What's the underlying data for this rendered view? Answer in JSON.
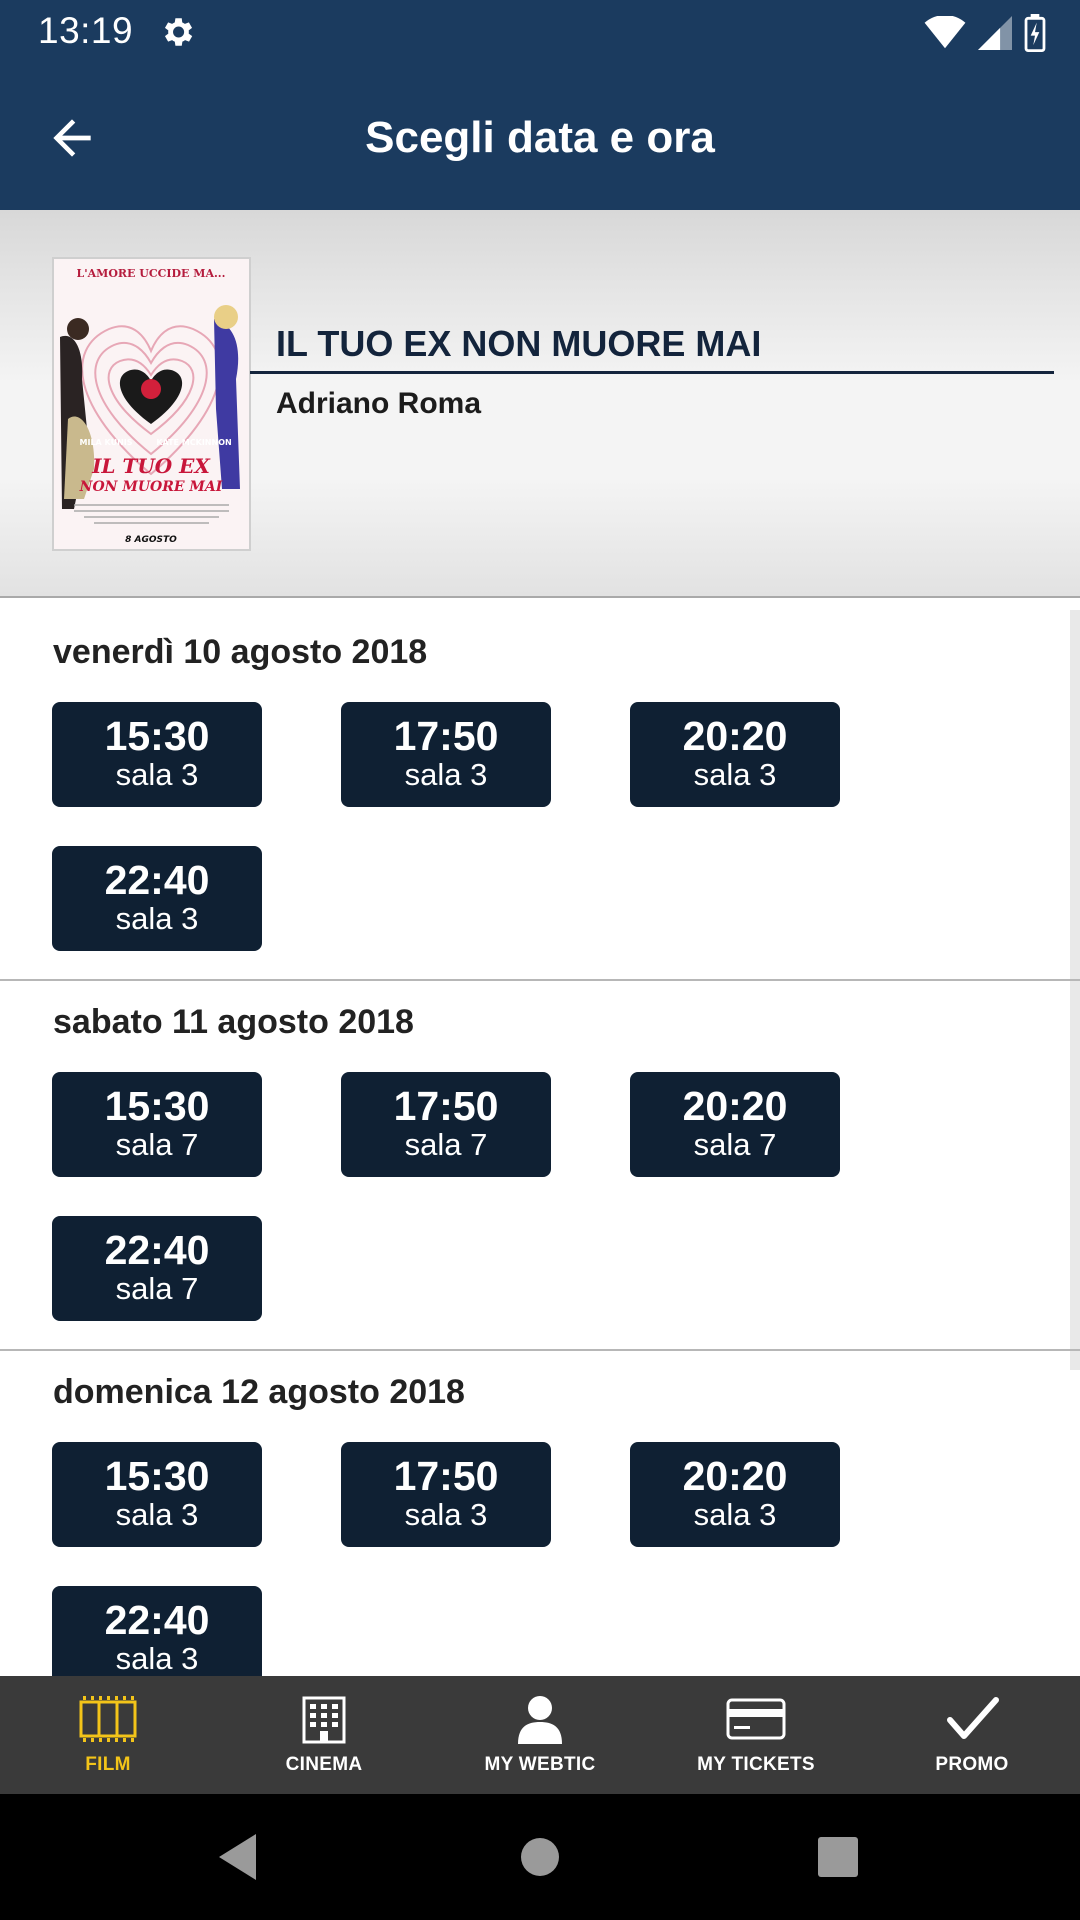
{
  "status_bar": {
    "time": "13:19"
  },
  "app_bar": {
    "title": "Scegli data e ora"
  },
  "film": {
    "title": "IL TUO EX NON MUORE MAI",
    "cinema": "Adriano Roma",
    "poster": {
      "tagline": "L'AMORE UCCIDE MA...",
      "actor_left": "MILA KUNIS",
      "actor_right": "KATE MCKINNON",
      "title_line1": "IL TUO EX",
      "title_line2": "NON MUORE MAI",
      "release": "8 AGOSTO"
    }
  },
  "days": [
    {
      "label": "venerdì 10 agosto 2018",
      "slots": [
        {
          "time": "15:30",
          "hall": "sala 3"
        },
        {
          "time": "17:50",
          "hall": "sala 3"
        },
        {
          "time": "20:20",
          "hall": "sala 3"
        },
        {
          "time": "22:40",
          "hall": "sala 3"
        }
      ]
    },
    {
      "label": "sabato 11 agosto 2018",
      "slots": [
        {
          "time": "15:30",
          "hall": "sala 7"
        },
        {
          "time": "17:50",
          "hall": "sala 7"
        },
        {
          "time": "20:20",
          "hall": "sala 7"
        },
        {
          "time": "22:40",
          "hall": "sala 7"
        }
      ]
    },
    {
      "label": "domenica 12 agosto 2018",
      "slots": [
        {
          "time": "15:30",
          "hall": "sala 3"
        },
        {
          "time": "17:50",
          "hall": "sala 3"
        },
        {
          "time": "20:20",
          "hall": "sala 3"
        },
        {
          "time": "22:40",
          "hall": "sala 3"
        }
      ]
    }
  ],
  "bottom_nav": {
    "items": [
      {
        "label": "FILM",
        "icon": "film-icon",
        "active": true
      },
      {
        "label": "CINEMA",
        "icon": "cinema-building-icon",
        "active": false
      },
      {
        "label": "MY WEBTIC",
        "icon": "user-icon",
        "active": false
      },
      {
        "label": "MY TICKETS",
        "icon": "card-icon",
        "active": false
      },
      {
        "label": "PROMO",
        "icon": "checkmark-icon",
        "active": false
      }
    ]
  },
  "colors": {
    "primary": "#1b3b5f",
    "slot": "#0f2033",
    "nav_bg": "#3a3a3a",
    "accent": "#f3c419"
  }
}
